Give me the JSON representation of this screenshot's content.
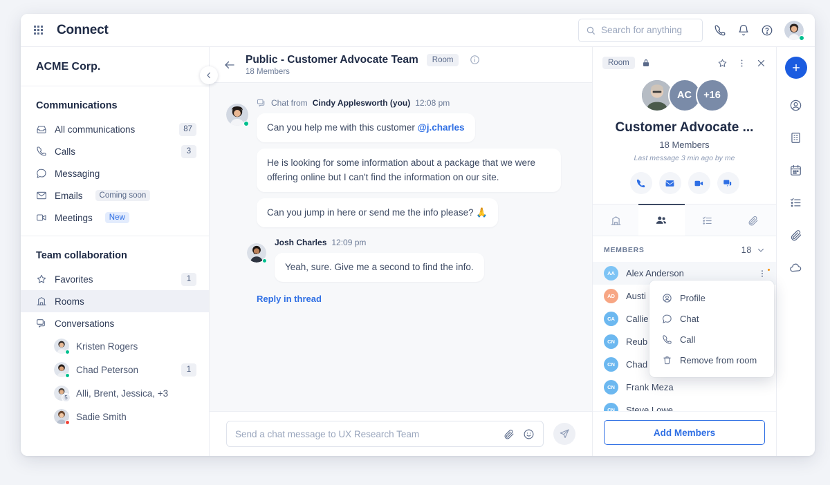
{
  "topbar": {
    "grid_icon": "apps-grid-icon",
    "brand": "Connect",
    "search": {
      "placeholder": "Search for anything",
      "value": "",
      "icon": "search-icon"
    },
    "icons": [
      {
        "name": "phone-icon",
        "label": "Calls"
      },
      {
        "name": "bell-icon",
        "label": "Notifications"
      },
      {
        "name": "help-icon",
        "label": "Help"
      }
    ],
    "avatar": {
      "name": "user-avatar",
      "status": "online"
    }
  },
  "sidebar": {
    "org_name": "ACME Corp.",
    "collapse_icon": "chevron-left-icon",
    "sections": [
      {
        "title": "Communications",
        "items": [
          {
            "label": "All communications",
            "icon": "inbox-icon",
            "badge": "87"
          },
          {
            "label": "Calls",
            "icon": "phone-icon",
            "badge": "3"
          },
          {
            "label": "Messaging",
            "icon": "chat-bubble-icon",
            "badge": ""
          },
          {
            "label": "Emails",
            "icon": "envelope-icon",
            "badge": "",
            "pill": "Coming soon",
            "pill_type": "soon"
          },
          {
            "label": "Meetings",
            "icon": "video-camera-icon",
            "badge": "",
            "pill": "New",
            "pill_type": "new"
          }
        ]
      },
      {
        "title": "Team collaboration",
        "items": [
          {
            "label": "Favorites",
            "icon": "star-icon",
            "badge": "1"
          },
          {
            "label": "Rooms",
            "icon": "building-icon",
            "badge": "",
            "active": true
          },
          {
            "label": "Conversations",
            "icon": "chats-icon",
            "badge": ""
          }
        ]
      }
    ],
    "conversations": [
      {
        "label": "Kristen Rogers",
        "status": "online",
        "badge": ""
      },
      {
        "label": "Chad Peterson",
        "status": "online",
        "badge": "1"
      },
      {
        "label": "Alli, Brent, Jessica, +3",
        "status": "group",
        "group_count": "5",
        "badge": ""
      },
      {
        "label": "Sadie Smith",
        "status": "busy",
        "badge": ""
      }
    ]
  },
  "chat": {
    "back_icon": "arrow-left-icon",
    "title": "Public - Customer Advocate Team",
    "tag": "Room",
    "subtitle": "18 Members",
    "info_icon": "info-circle-icon",
    "groups": [
      {
        "channel_icon": "chats-icon",
        "prefix": "Chat from",
        "author": "Cindy Applesworth (you)",
        "time": "12:08 pm",
        "avatar_status": "online",
        "messages": [
          {
            "text": "Can you help me with this customer ",
            "mention": "@j.charles",
            "wide": false
          },
          {
            "text": "He is looking for some information about a package that we were offering online but I can't find the information on our site.",
            "mention": "",
            "wide": true
          },
          {
            "text": "Can you jump in here or send me the info please? 🙏",
            "mention": "",
            "wide": false
          }
        ]
      },
      {
        "channel_icon": "",
        "prefix": "",
        "author": "Josh Charles",
        "time": "12:09 pm",
        "avatar_status": "online",
        "messages": [
          {
            "text": "Yeah, sure. Give me a second to find the info.",
            "mention": "",
            "wide": false
          }
        ]
      }
    ],
    "reply_link": "Reply in thread",
    "composer": {
      "placeholder": "Send a chat message to UX Research Team",
      "value": "",
      "attach_icon": "paperclip-icon",
      "emoji_icon": "smiley-icon",
      "send_icon": "send-icon"
    }
  },
  "right_panel": {
    "tag": "Room",
    "lock_icon": "lock-icon",
    "actions": [
      {
        "name": "star-icon"
      },
      {
        "name": "more-vertical-icon"
      },
      {
        "name": "close-icon"
      }
    ],
    "avatars": [
      {
        "type": "image",
        "label": "",
        "color": "#8f9aa8"
      },
      {
        "type": "initials",
        "label": "AC",
        "color": "#7a8ba8"
      },
      {
        "type": "count",
        "label": "+16",
        "color": "#7a8ba8"
      }
    ],
    "room_name": "Customer Advocate ...",
    "members_line": "18 Members",
    "last_message": "Last message 3 min ago by me",
    "quick_actions": [
      {
        "name": "phone-icon"
      },
      {
        "name": "envelope-icon"
      },
      {
        "name": "video-camera-icon"
      },
      {
        "name": "chats-icon"
      }
    ],
    "tabs": [
      {
        "name": "tab-about",
        "icon": "building-icon",
        "active": false
      },
      {
        "name": "tab-members",
        "icon": "people-icon",
        "active": true
      },
      {
        "name": "tab-tasks",
        "icon": "list-checks-icon",
        "active": false
      },
      {
        "name": "tab-files",
        "icon": "paperclip-icon",
        "active": false
      }
    ],
    "members_header": "MEMBERS",
    "members_count": "18",
    "members_chevron": "chevron-down-icon",
    "members": [
      {
        "name": "Alex Anderson",
        "initials": "AA",
        "color": "#7ec4f5",
        "highlighted": true
      },
      {
        "name": "Austi",
        "initials": "AD",
        "color": "#f7a684",
        "highlighted": false
      },
      {
        "name": "Callie",
        "initials": "CA",
        "color": "#6cb8f0",
        "highlighted": false
      },
      {
        "name": "Reub",
        "initials": "CN",
        "color": "#6cb8f0",
        "highlighted": false
      },
      {
        "name": "Chad",
        "initials": "CN",
        "color": "#6cb8f0",
        "highlighted": false
      },
      {
        "name": "Frank Meza",
        "initials": "CN",
        "color": "#6cb8f0",
        "highlighted": false
      },
      {
        "name": "Steve Lowe",
        "initials": "CN",
        "color": "#6cb8f0",
        "highlighted": false
      }
    ],
    "add_members_label": "Add Members",
    "context_menu": [
      {
        "label": "Profile",
        "icon": "profile-icon"
      },
      {
        "label": "Chat",
        "icon": "chat-bubble-icon"
      },
      {
        "label": "Call",
        "icon": "phone-icon"
      },
      {
        "label": "Remove from room",
        "icon": "trash-icon"
      }
    ]
  },
  "rail": {
    "add_icon": "plus-icon",
    "items": [
      {
        "name": "contact-icon"
      },
      {
        "name": "building-icon"
      },
      {
        "name": "calendar-icon"
      },
      {
        "name": "list-checks-icon"
      },
      {
        "name": "paperclip-icon"
      },
      {
        "name": "cloud-icon"
      }
    ]
  },
  "colors": {
    "accent": "#2f6fe4",
    "accent_strong": "#1b5ce0",
    "text_dark": "#1e2a45",
    "text_muted": "#6b7a96",
    "online": "#00bf8e",
    "busy": "#f04438",
    "canvas": "#f2f4f8"
  }
}
